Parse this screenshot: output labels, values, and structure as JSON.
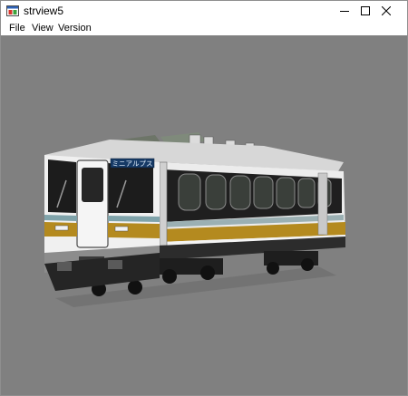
{
  "window": {
    "title": "strview5",
    "controls": {
      "minimize": "minimize-icon",
      "maximize": "maximize-icon",
      "close": "close-icon"
    }
  },
  "menu": {
    "items": [
      {
        "label": "File"
      },
      {
        "label": "View"
      },
      {
        "label": "Version"
      }
    ]
  },
  "viewport": {
    "background": "#808080",
    "train": {
      "destination_sign": "ミニアルプス",
      "body_color": "#ececec",
      "stripe_color": "#b48a1f",
      "accent_color": "#2b8e9c"
    }
  }
}
